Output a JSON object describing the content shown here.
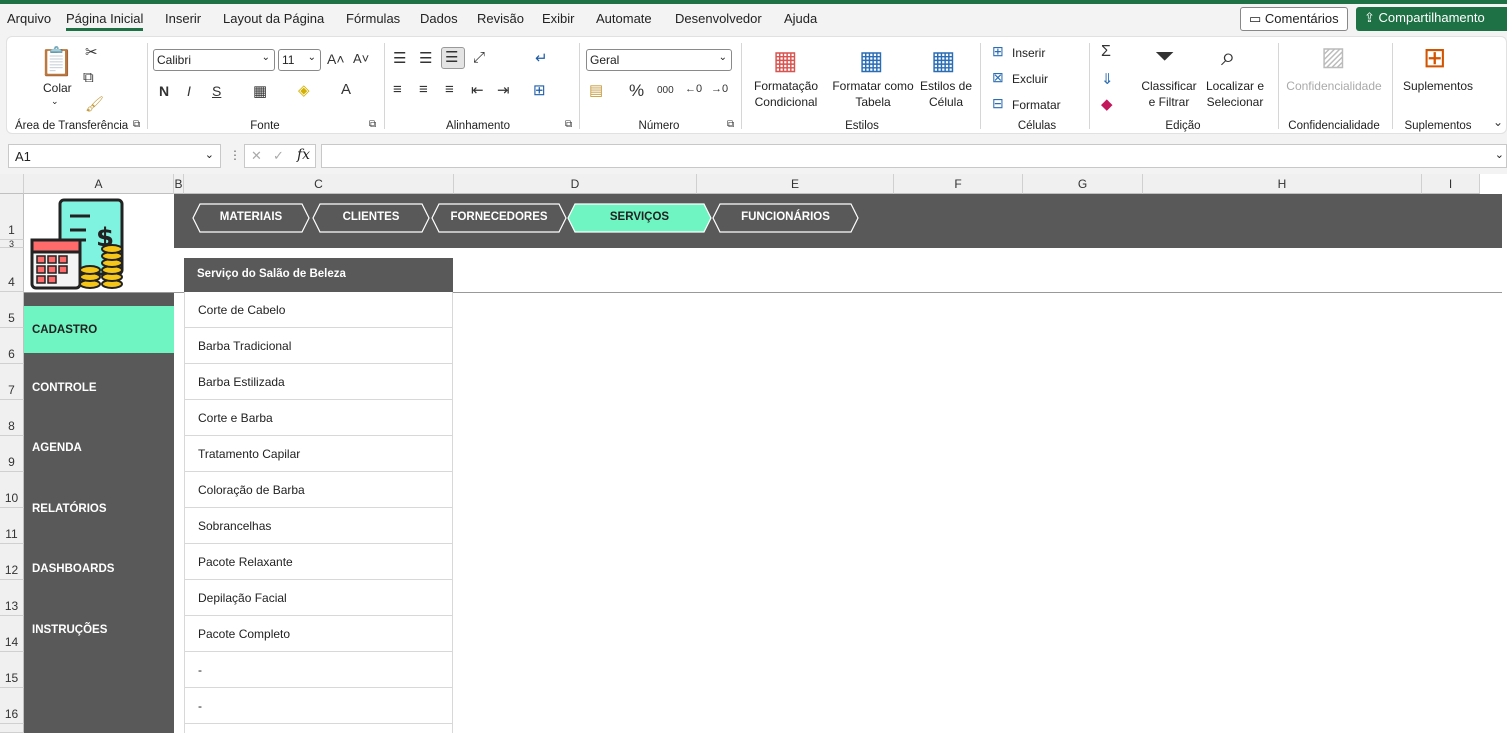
{
  "menu": {
    "items": [
      "Arquivo",
      "Página Inicial",
      "Inserir",
      "Layout da Página",
      "Fórmulas",
      "Dados",
      "Revisão",
      "Exibir",
      "Automate",
      "Desenvolvedor",
      "Ajuda"
    ],
    "comments": "Comentários",
    "share": "Compartilhamento"
  },
  "ribbon": {
    "clipboard": {
      "paste": "Colar",
      "label": "Área de Transferência"
    },
    "font": {
      "name": "Calibri",
      "size": "11",
      "label": "Fonte",
      "bold": "N",
      "italic": "I",
      "underline": "S"
    },
    "alignment": {
      "label": "Alinhamento"
    },
    "number": {
      "format": "Geral",
      "label": "Número"
    },
    "styles": {
      "cond1": "Formatação",
      "cond2": "Condicional",
      "table1": "Formatar como",
      "table2": "Tabela",
      "cell1": "Estilos de",
      "cell2": "Célula",
      "label": "Estilos"
    },
    "cells": {
      "insert": "Inserir",
      "delete": "Excluir",
      "format": "Formatar",
      "label": "Células"
    },
    "editing": {
      "sort1": "Classificar",
      "sort2": "e Filtrar",
      "find1": "Localizar e",
      "find2": "Selecionar",
      "label": "Edição"
    },
    "sensitivity": {
      "button": "Confidencialidade",
      "label": "Confidencialidade"
    },
    "addins": {
      "button": "Suplementos",
      "label": "Suplementos"
    }
  },
  "formula_bar": {
    "name_box": "A1",
    "fx": "fx",
    "value": ""
  },
  "columns": [
    "A",
    "B",
    "C",
    "D",
    "E",
    "F",
    "G",
    "H",
    "I"
  ],
  "rows": [
    "1",
    "3",
    "4",
    "5",
    "6",
    "7",
    "8",
    "9",
    "10",
    "11",
    "12",
    "13",
    "14",
    "15",
    "16"
  ],
  "nav_tabs": [
    "MATERIAIS",
    "CLIENTES",
    "FORNECEDORES",
    "SERVIÇOS",
    "FUNCIONÁRIOS"
  ],
  "active_tab": "SERVIÇOS",
  "sidebar": [
    "CADASTRO",
    "CONTROLE",
    "AGENDA",
    "RELATÓRIOS",
    "DASHBOARDS",
    "INSTRUÇÕES"
  ],
  "table": {
    "header": "Serviço do Salão de Beleza",
    "rows": [
      "Corte de Cabelo",
      "Barba Tradicional",
      "Barba Estilizada",
      "Corte e Barba",
      "Tratamento Capilar",
      "Coloração de Barba",
      "Sobrancelhas",
      "Pacote Relaxante",
      "Depilação Facial",
      "Pacote Completo",
      "-",
      "-"
    ]
  },
  "colors": {
    "accent": "#6ff5c2",
    "dark": "#595959",
    "excel_green": "#1e7145"
  }
}
